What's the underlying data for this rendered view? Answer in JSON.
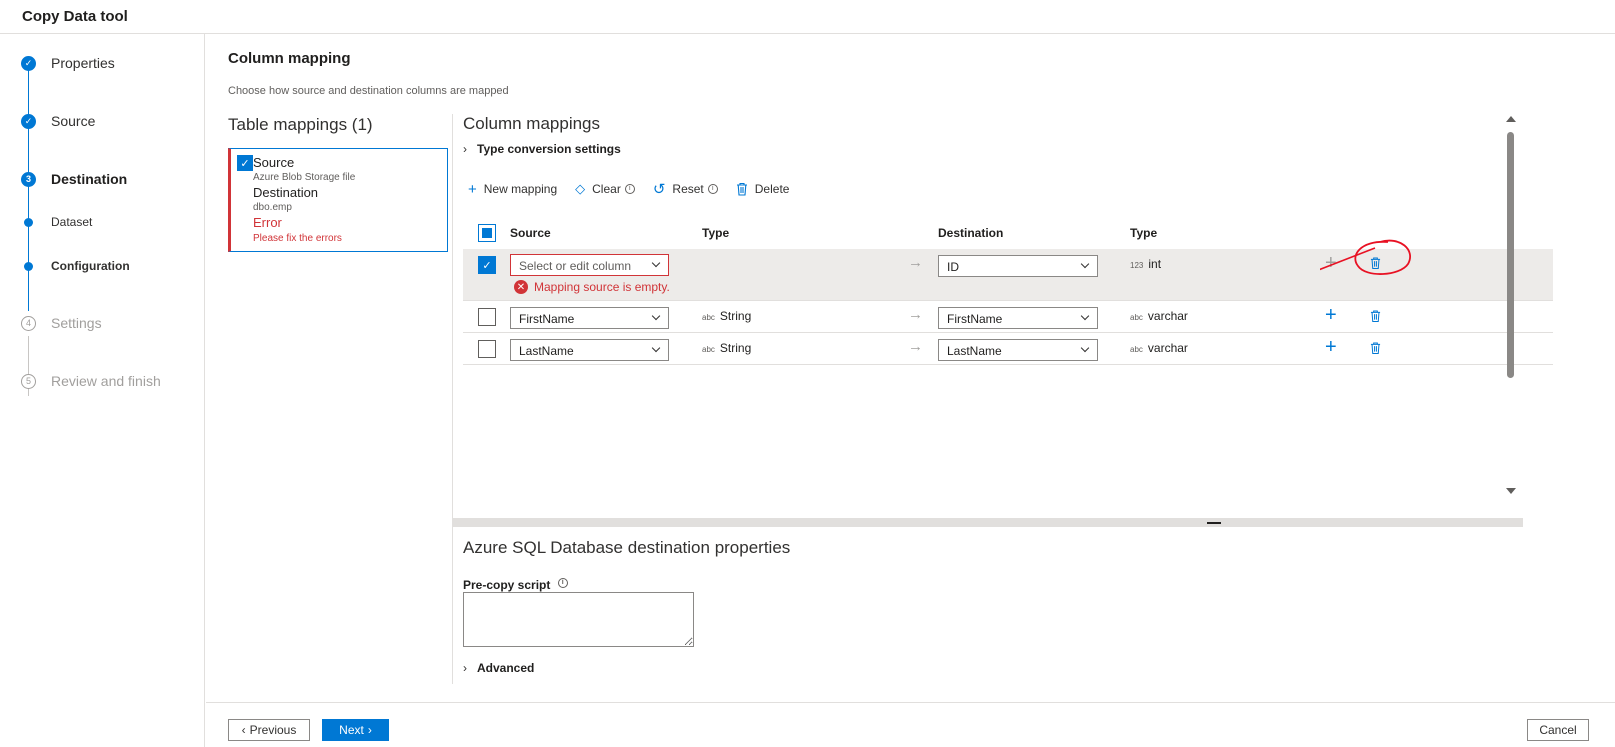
{
  "app": {
    "title": "Copy Data tool"
  },
  "steps": [
    {
      "label": "Properties",
      "marker": "✓"
    },
    {
      "label": "Source",
      "marker": "✓"
    },
    {
      "label": "Destination",
      "marker": "3"
    },
    {
      "label": "Dataset",
      "marker": ""
    },
    {
      "label": "Configuration",
      "marker": ""
    },
    {
      "label": "Settings",
      "marker": "4"
    },
    {
      "label": "Review and finish",
      "marker": "5"
    }
  ],
  "page": {
    "heading": "Column mapping",
    "subheading": "Choose how source and destination columns are mapped"
  },
  "table_mappings": {
    "title": "Table mappings (1)",
    "card": {
      "source_label": "Source",
      "source_value": "Azure Blob Storage file",
      "destination_label": "Destination",
      "destination_value": "dbo.emp",
      "error_label": "Error",
      "error_value": "Please fix the errors"
    }
  },
  "column_mappings": {
    "title": "Column mappings",
    "type_conversion": "Type conversion settings",
    "toolbar": {
      "new_mapping": "New mapping",
      "clear": "Clear",
      "reset": "Reset",
      "delete": "Delete"
    },
    "headers": {
      "source": "Source",
      "source_type": "Type",
      "destination": "Destination",
      "destination_type": "Type"
    },
    "rows": [
      {
        "checked": true,
        "source": "Select or edit column",
        "source_type": "",
        "source_type_prefix": "",
        "destination": "ID",
        "destination_type": "int",
        "destination_type_prefix": "123",
        "error": "Mapping source is empty."
      },
      {
        "checked": false,
        "source": "FirstName",
        "source_type": "String",
        "source_type_prefix": "abc",
        "destination": "FirstName",
        "destination_type": "varchar",
        "destination_type_prefix": "abc",
        "error": ""
      },
      {
        "checked": false,
        "source": "LastName",
        "source_type": "String",
        "source_type_prefix": "abc",
        "destination": "LastName",
        "destination_type": "varchar",
        "destination_type_prefix": "abc",
        "error": ""
      }
    ]
  },
  "destination_properties": {
    "title": "Azure SQL Database destination properties",
    "pre_copy_label": "Pre-copy script",
    "pre_copy_value": "",
    "advanced": "Advanced"
  },
  "footer": {
    "previous": "Previous",
    "next": "Next",
    "cancel": "Cancel"
  },
  "colors": {
    "accent": "#0078d4",
    "error": "#d13438",
    "annotation": "#e81123"
  }
}
